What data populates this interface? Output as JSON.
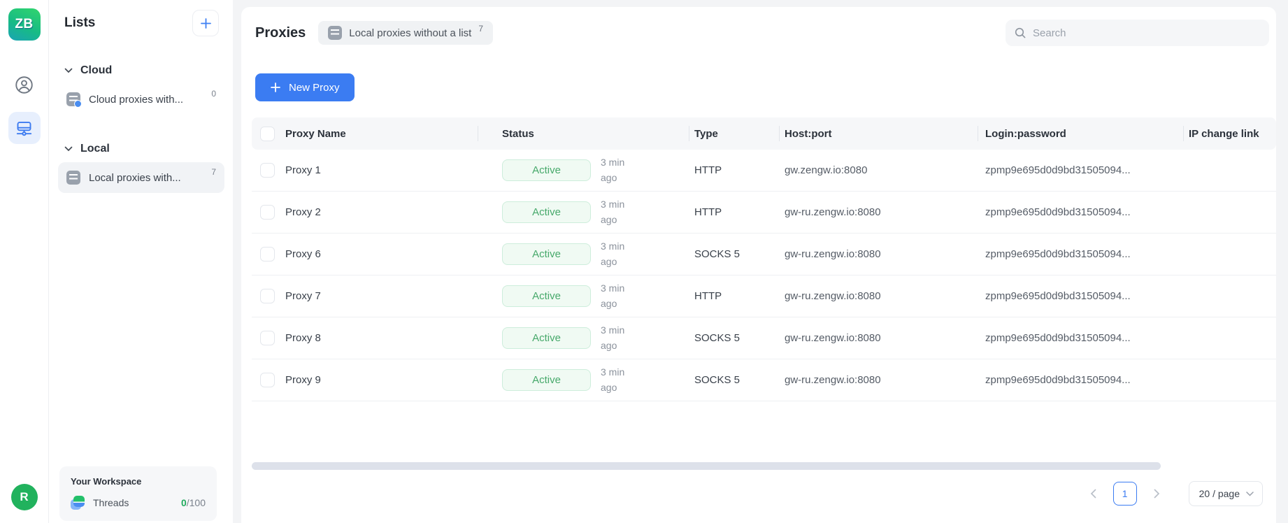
{
  "brand": {
    "logo_text": "ZB"
  },
  "sidebar": {
    "rail_icons": [
      "user-account-icon",
      "proxies-network-icon"
    ],
    "avatar_letter": "R",
    "lists": {
      "title": "Lists",
      "add_icon": "plus-icon",
      "groups": [
        {
          "label": "Cloud",
          "items": [
            {
              "label": "Cloud proxies with...",
              "count": "0",
              "selected": false
            }
          ]
        },
        {
          "label": "Local",
          "items": [
            {
              "label": "Local proxies with...",
              "count": "7",
              "selected": true
            }
          ]
        }
      ]
    },
    "workspace": {
      "title": "Your Workspace",
      "threads_label": "Threads",
      "used": "0",
      "quota": "/100"
    }
  },
  "header": {
    "title": "Proxies",
    "badge": {
      "label": "Local proxies without a list",
      "count": "7"
    },
    "search_placeholder": "Search"
  },
  "toolbar": {
    "new_proxy_label": "New Proxy",
    "plus_icon": "plus-icon"
  },
  "table": {
    "columns": [
      "Proxy Name",
      "Status",
      "Type",
      "Host:port",
      "Login:password",
      "IP change link"
    ],
    "rows": [
      {
        "name": "Proxy 1",
        "status": "Active",
        "age": "3 min ago",
        "type": "HTTP",
        "host": "gw.zengw.io:8080",
        "login": "zpmp9e695d0d9bd31505094..."
      },
      {
        "name": "Proxy 2",
        "status": "Active",
        "age": "3 min ago",
        "type": "HTTP",
        "host": "gw-ru.zengw.io:8080",
        "login": "zpmp9e695d0d9bd31505094..."
      },
      {
        "name": "Proxy 6",
        "status": "Active",
        "age": "3 min ago",
        "type": "SOCKS 5",
        "host": "gw-ru.zengw.io:8080",
        "login": "zpmp9e695d0d9bd31505094..."
      },
      {
        "name": "Proxy 7",
        "status": "Active",
        "age": "3 min ago",
        "type": "HTTP",
        "host": "gw-ru.zengw.io:8080",
        "login": "zpmp9e695d0d9bd31505094..."
      },
      {
        "name": "Proxy 8",
        "status": "Active",
        "age": "3 min ago",
        "type": "SOCKS 5",
        "host": "gw-ru.zengw.io:8080",
        "login": "zpmp9e695d0d9bd31505094..."
      },
      {
        "name": "Proxy 9",
        "status": "Active",
        "age": "3 min ago",
        "type": "SOCKS 5",
        "host": "gw-ru.zengw.io:8080",
        "login": "zpmp9e695d0d9bd31505094..."
      }
    ]
  },
  "pagination": {
    "prev_icon": "chevron-left-icon",
    "current_page": "1",
    "next_icon": "chevron-right-icon",
    "page_size": "20 / page",
    "page_size_icon": "chevron-down-icon"
  },
  "colors": {
    "accent_blue": "#3b7cf2",
    "active_text": "#47a96b",
    "active_bg": "#f0faf3",
    "active_border": "#cdeddb",
    "avatar_green": "#21b25d",
    "threads_used_green": "#22ab5e",
    "scrollbar": "#dde1ea"
  }
}
